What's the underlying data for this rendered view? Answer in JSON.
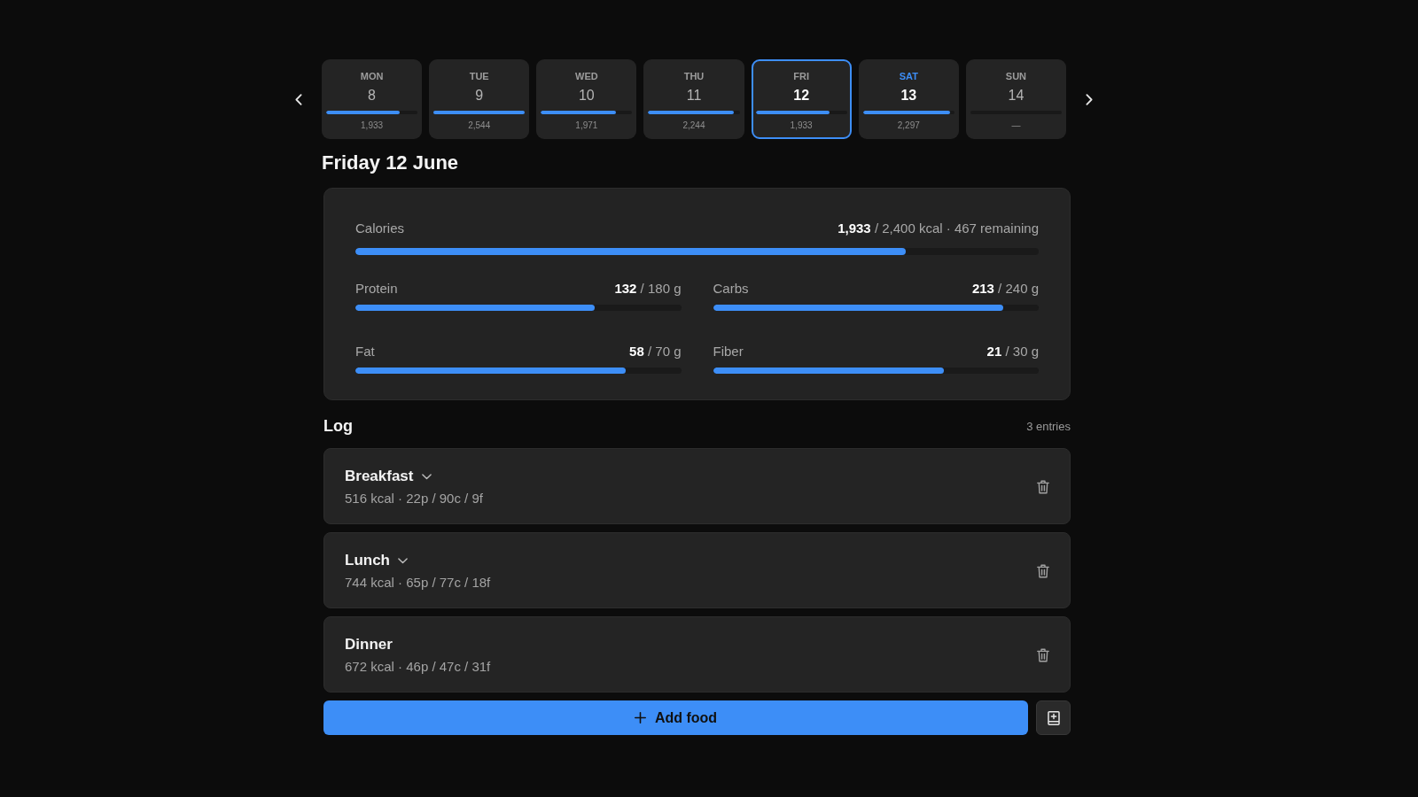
{
  "days": [
    {
      "weekday": "MON",
      "date": "8",
      "calories": "1,933",
      "level": 0.805,
      "selected": false,
      "today": false
    },
    {
      "weekday": "TUE",
      "date": "9",
      "calories": "2,544",
      "level": 1,
      "selected": false,
      "today": false
    },
    {
      "weekday": "WED",
      "date": "10",
      "calories": "1,971",
      "level": 0.82,
      "selected": false,
      "today": false
    },
    {
      "weekday": "THU",
      "date": "11",
      "calories": "2,244",
      "level": 0.935,
      "selected": false,
      "today": false
    },
    {
      "weekday": "FRI",
      "date": "12",
      "calories": "1,933",
      "level": 0.805,
      "selected": true,
      "today": false
    },
    {
      "weekday": "SAT",
      "date": "13",
      "calories": "2,297",
      "level": 0.957,
      "selected": false,
      "today": true
    },
    {
      "weekday": "SUN",
      "date": "14",
      "calories": "—",
      "selected": false,
      "today": false
    }
  ],
  "title": "Friday 12 June",
  "summary": {
    "calories": {
      "label": "Calories",
      "reading": "**1,933** / 2,400 kcal · 467 remaining",
      "level": 0.805
    },
    "macros": [
      {
        "label": "Protein",
        "reading": "**132** / 180 g",
        "level": 0.735
      },
      {
        "label": "Carbs",
        "reading": "**213** / 240 g",
        "level": 0.89
      },
      {
        "label": "Fat",
        "reading": "**58** / 70 g",
        "level": 0.83
      },
      {
        "label": "Fiber",
        "reading": "**21** / 30 g",
        "level": 0.71
      }
    ]
  },
  "log": {
    "title": "Log",
    "count": "3 entries",
    "entries": [
      {
        "name": "Breakfast",
        "expandable": true,
        "summary": "516 kcal · 22p / 90c / 9f"
      },
      {
        "name": "Lunch",
        "expandable": true,
        "summary": "744 kcal · 65p / 77c / 18f"
      },
      {
        "name": "Dinner",
        "expandable": false,
        "summary": "672 kcal · 46p / 47c / 31f"
      }
    ]
  },
  "actions": {
    "add_label": "Add food"
  }
}
